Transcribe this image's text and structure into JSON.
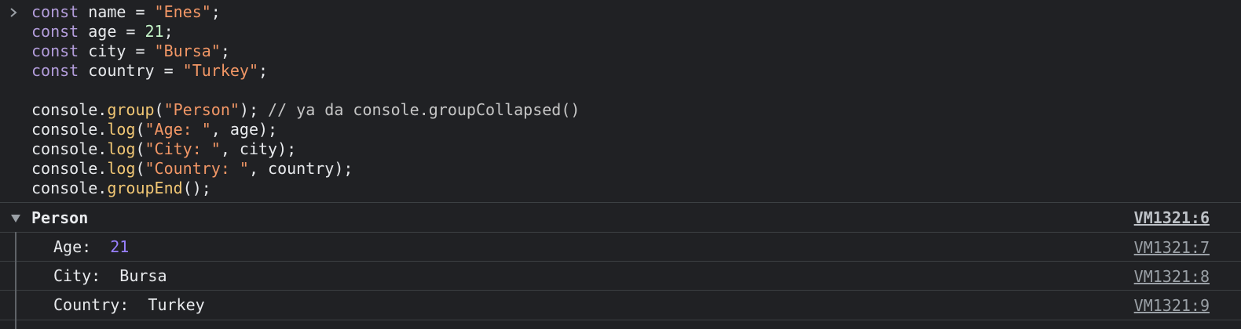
{
  "input": {
    "prompt_icon": "chevron-right-icon",
    "code_lines": [
      [
        {
          "t": "kw",
          "v": "const"
        },
        {
          "t": "id",
          "v": " name = "
        },
        {
          "t": "str",
          "v": "\"Enes\""
        },
        {
          "t": "id",
          "v": ";"
        }
      ],
      [
        {
          "t": "kw",
          "v": "const"
        },
        {
          "t": "id",
          "v": " age = "
        },
        {
          "t": "num",
          "v": "21"
        },
        {
          "t": "id",
          "v": ";"
        }
      ],
      [
        {
          "t": "kw",
          "v": "const"
        },
        {
          "t": "id",
          "v": " city = "
        },
        {
          "t": "str",
          "v": "\"Bursa\""
        },
        {
          "t": "id",
          "v": ";"
        }
      ],
      [
        {
          "t": "kw",
          "v": "const"
        },
        {
          "t": "id",
          "v": " country = "
        },
        {
          "t": "str",
          "v": "\"Turkey\""
        },
        {
          "t": "id",
          "v": ";"
        }
      ],
      [],
      [
        {
          "t": "id",
          "v": "console."
        },
        {
          "t": "fn",
          "v": "group"
        },
        {
          "t": "id",
          "v": "("
        },
        {
          "t": "str",
          "v": "\"Person\""
        },
        {
          "t": "id",
          "v": "); "
        },
        {
          "t": "cm",
          "v": "// ya da console.groupCollapsed()"
        }
      ],
      [
        {
          "t": "id",
          "v": "console."
        },
        {
          "t": "fn",
          "v": "log"
        },
        {
          "t": "id",
          "v": "("
        },
        {
          "t": "str",
          "v": "\"Age: \""
        },
        {
          "t": "id",
          "v": ", age);"
        }
      ],
      [
        {
          "t": "id",
          "v": "console."
        },
        {
          "t": "fn",
          "v": "log"
        },
        {
          "t": "id",
          "v": "("
        },
        {
          "t": "str",
          "v": "\"City: \""
        },
        {
          "t": "id",
          "v": ", city);"
        }
      ],
      [
        {
          "t": "id",
          "v": "console."
        },
        {
          "t": "fn",
          "v": "log"
        },
        {
          "t": "id",
          "v": "("
        },
        {
          "t": "str",
          "v": "\"Country: \""
        },
        {
          "t": "id",
          "v": ", country);"
        }
      ],
      [
        {
          "t": "id",
          "v": "console."
        },
        {
          "t": "fn",
          "v": "groupEnd"
        },
        {
          "t": "id",
          "v": "();"
        }
      ]
    ]
  },
  "group": {
    "label": "Person",
    "toggle_icon": "triangle-down-icon",
    "source": "VM1321:6",
    "entries": [
      {
        "label": "Age: ",
        "value": "21",
        "value_type": "number",
        "source": "VM1321:7"
      },
      {
        "label": "City: ",
        "value": "Bursa",
        "value_type": "string",
        "source": "VM1321:8"
      },
      {
        "label": "Country: ",
        "value": "Turkey",
        "value_type": "string",
        "source": "VM1321:9"
      }
    ]
  },
  "colors": {
    "background": "#202124",
    "keyword": "#b39ddb",
    "string": "#f29766",
    "number_literal": "#c5f5c9",
    "function": "#f0c674",
    "number_value": "#9980ff",
    "text": "#e8eaed",
    "source_link": "#9aa0a6"
  }
}
